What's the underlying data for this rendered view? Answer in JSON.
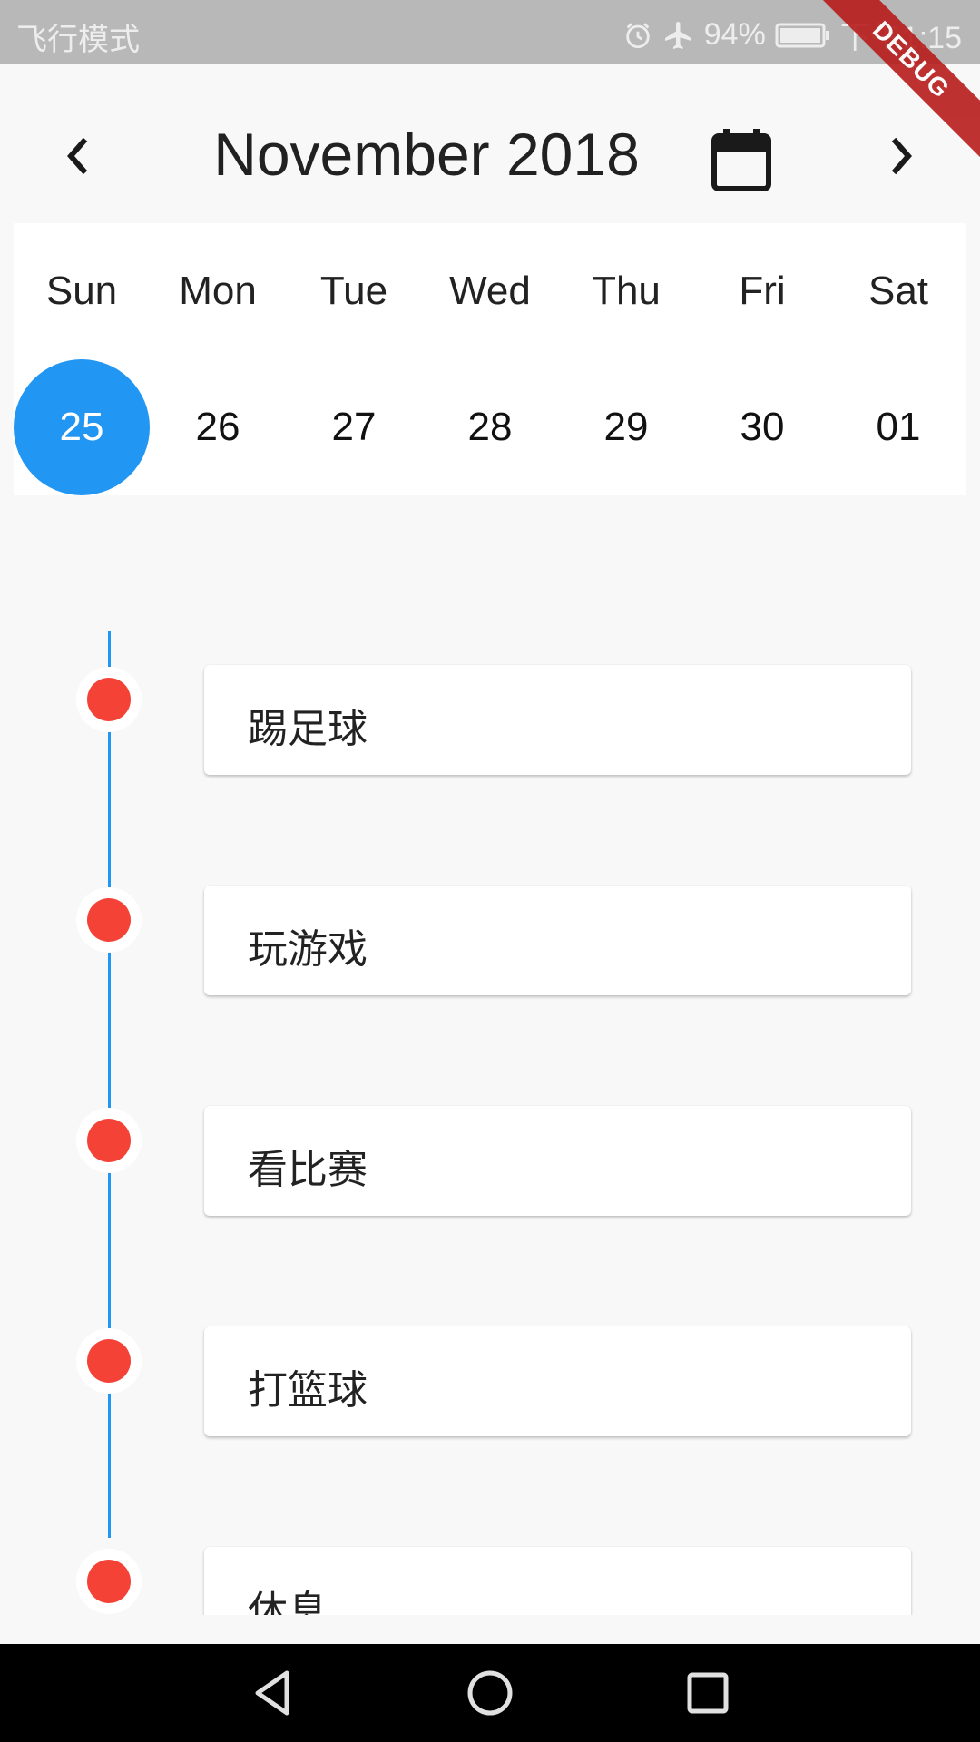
{
  "status_bar": {
    "left_text": "飞行模式",
    "battery": "94%",
    "time": "下午1:15",
    "icons": [
      "alarm-icon",
      "airplane-icon",
      "battery-icon"
    ]
  },
  "debug_banner": "DEBUG",
  "header": {
    "title": "November 2018",
    "prev_icon": "chevron-left-icon",
    "next_icon": "chevron-right-icon",
    "calendar_icon": "calendar-icon"
  },
  "week": {
    "days": [
      "Sun",
      "Mon",
      "Tue",
      "Wed",
      "Thu",
      "Fri",
      "Sat"
    ],
    "dates": [
      "25",
      "26",
      "27",
      "28",
      "29",
      "30",
      "01"
    ],
    "selected_index": 0,
    "selected_color": "#2196f3"
  },
  "timeline": {
    "line_color": "#2196f3",
    "dot_color": "#f44336",
    "events": [
      {
        "label": "踢足球"
      },
      {
        "label": "玩游戏"
      },
      {
        "label": "看比赛"
      },
      {
        "label": "打篮球"
      },
      {
        "label": "休息"
      }
    ]
  },
  "nav_bar": {
    "icons": [
      "back-icon",
      "home-icon",
      "recents-icon"
    ]
  }
}
